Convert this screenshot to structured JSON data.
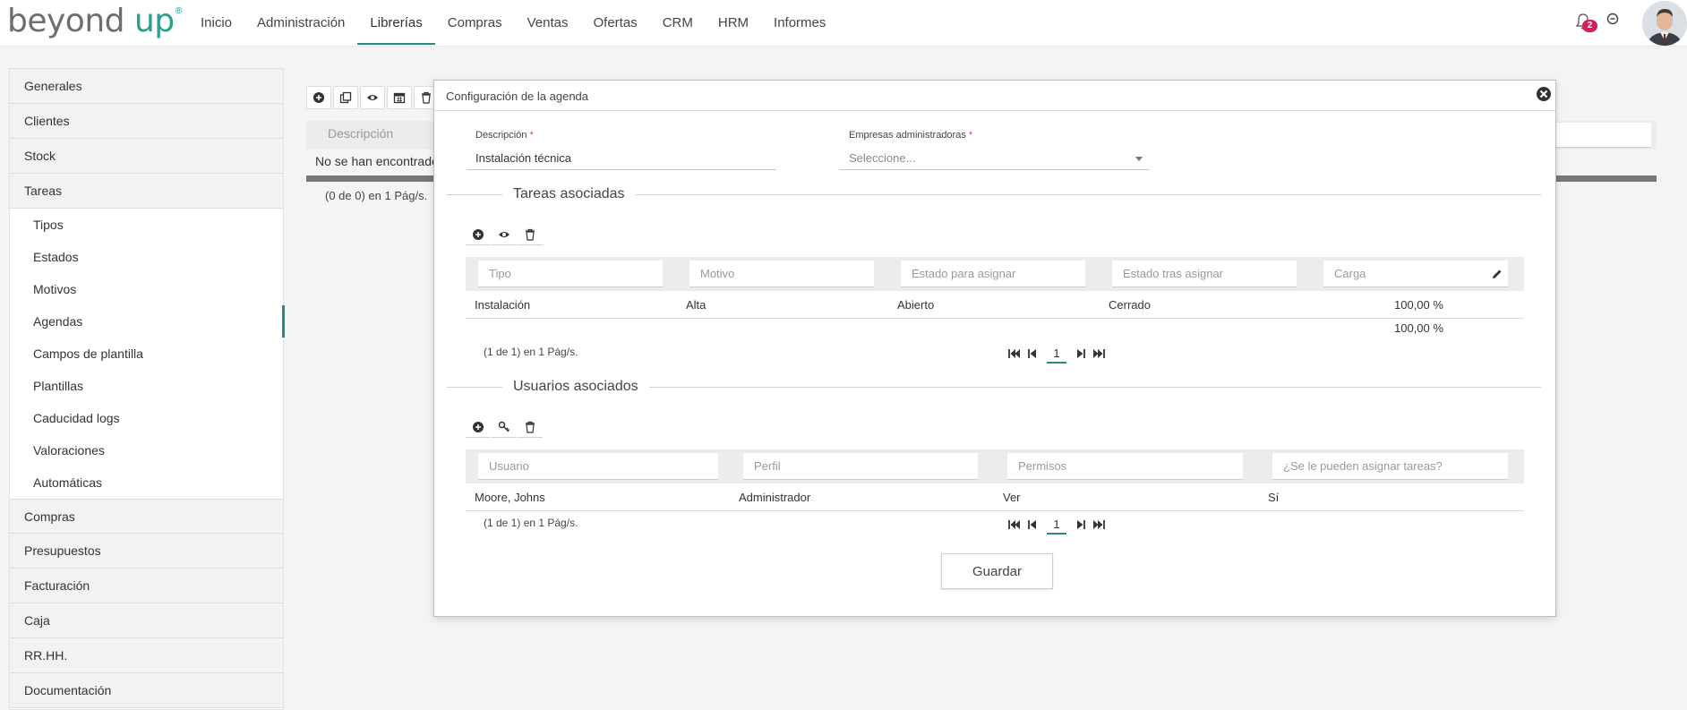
{
  "brand": {
    "part1": "beyond",
    "part2": "up",
    "reg": "®"
  },
  "nav": {
    "items": [
      {
        "label": "Inicio"
      },
      {
        "label": "Administración"
      },
      {
        "label": "Librerías"
      },
      {
        "label": "Compras"
      },
      {
        "label": "Ventas"
      },
      {
        "label": "Ofertas"
      },
      {
        "label": "CRM"
      },
      {
        "label": "HRM"
      },
      {
        "label": "Informes"
      }
    ],
    "active_index": 2
  },
  "top_icons": {
    "notifications_count": "2",
    "bell_icon": "bell-icon",
    "add_icon": "plus-circle-icon"
  },
  "sidebar": {
    "groups_top": [
      "Generales",
      "Clientes",
      "Stock",
      "Tareas"
    ],
    "tareas_items": [
      "Tipos",
      "Estados",
      "Motivos",
      "Agendas",
      "Campos de plantilla",
      "Plantillas",
      "Caducidad logs",
      "Valoraciones",
      "Automáticas"
    ],
    "active_sub": "Agendas",
    "groups_bottom": [
      "Compras",
      "Presupuestos",
      "Facturación",
      "Caja",
      "RR.HH.",
      "Documentación"
    ]
  },
  "background": {
    "filter_placeholder": "Descripción",
    "empty_text": "No se han encontrado",
    "pagination": "(0 de 0) en 1 Pág/s."
  },
  "modal": {
    "title": "Configuración de la agenda",
    "descripcion_label": "Descripción",
    "descripcion_value": "Instalación técnica",
    "empresas_label": "Empresas administradoras",
    "empresas_placeholder": "Seleccione...",
    "required_mark": "*",
    "tareas_section": "Tareas asociadas",
    "tareas_filters": [
      "Tipo",
      "Motivo",
      "Estado para asignar",
      "Estado tras asignar",
      "Carga"
    ],
    "tareas_row": {
      "tipo": "Instalación",
      "motivo": "Alta",
      "estado_asignar": "Abierto",
      "estado_tras": "Cerrado",
      "carga": "100,00 %"
    },
    "tareas_total": "100,00 %",
    "tareas_pagination": "(1 de 1) en 1 Pág/s.",
    "tareas_page": "1",
    "usuarios_section": "Usuarios asociados",
    "usuarios_filters": [
      "Usuario",
      "Perfil",
      "Permisos",
      "¿Se le pueden asignar tareas?"
    ],
    "usuarios_row": {
      "usuario": "Moore, Johns",
      "perfil": "Administrador",
      "permisos": "Ver",
      "asignar": "Sí"
    },
    "usuarios_pagination": "(1 de 1) en 1 Pág/s.",
    "usuarios_page": "1",
    "save_label": "Guardar"
  },
  "colors": {
    "accent": "#1f8c85",
    "badge": "#d91e5b",
    "required": "#d9443b"
  }
}
